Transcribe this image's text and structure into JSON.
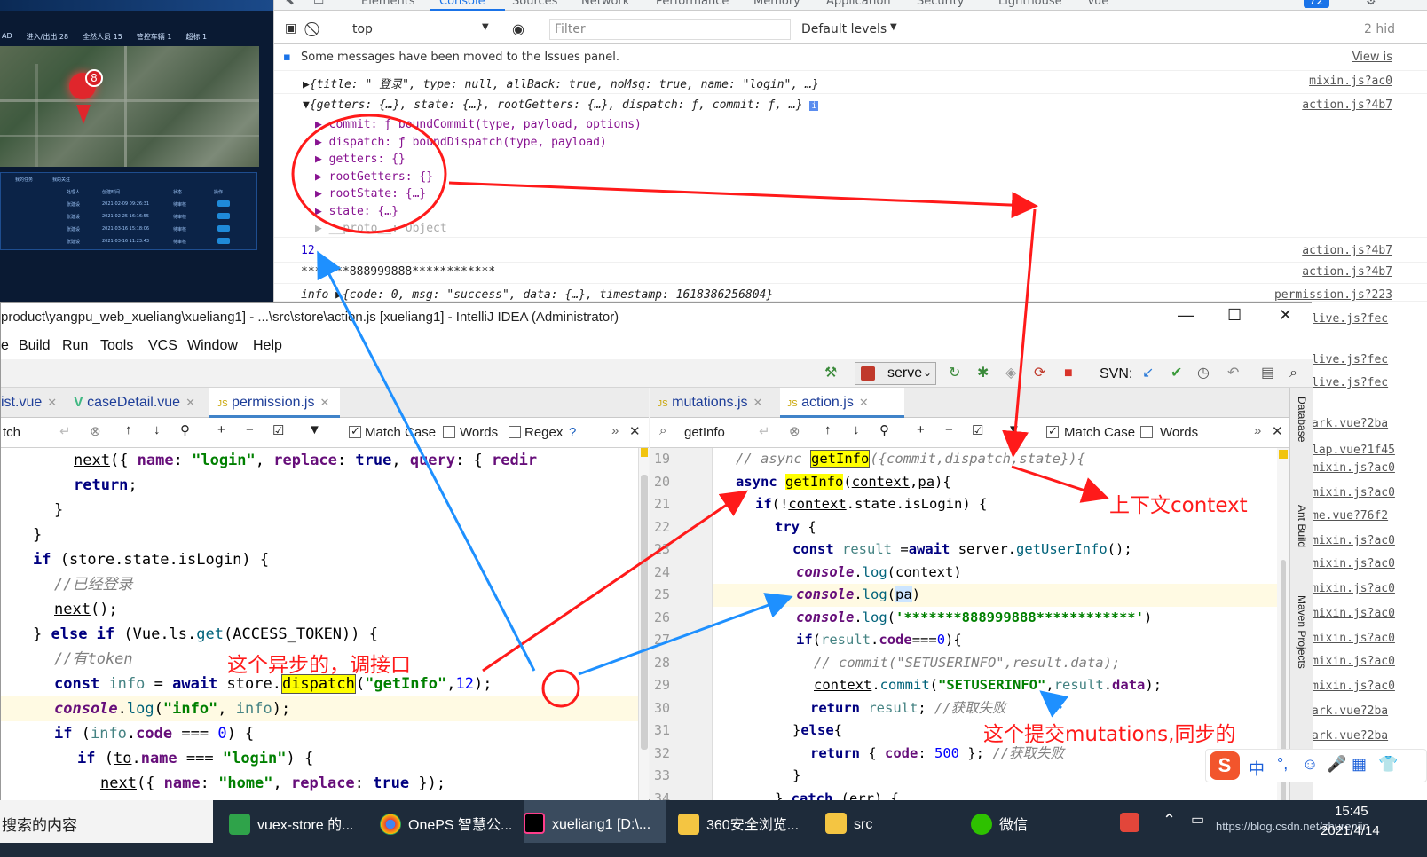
{
  "map_app": {
    "kpis": [
      "AD",
      "进入/出出 28",
      "全然人员 15",
      "管控车辆 1",
      "超标 1"
    ],
    "pin_count": "8",
    "table_header": [
      "我的任务",
      "我的关注"
    ],
    "table_cols": [
      "处理人",
      "创建时间",
      "状态",
      "操作"
    ],
    "table_rows": [
      {
        "who": "张建设",
        "date": "2021-02-09 09:26:31",
        "status": "待审核"
      },
      {
        "who": "张建设",
        "date": "2021-02-25 16:16:55",
        "status": "待审核"
      },
      {
        "who": "张建设",
        "date": "2021-03-16 15:18:06",
        "status": "待审核"
      },
      {
        "who": "张建设",
        "date": "2021-03-16 11:23:43",
        "status": "待审核"
      }
    ]
  },
  "devtools": {
    "tabs": [
      "Elements",
      "Console",
      "Sources",
      "Network",
      "Performance",
      "Memory",
      "Application",
      "Security",
      "Lighthouse",
      "Vue"
    ],
    "badge": "72",
    "context": "top",
    "filter_placeholder": "Filter",
    "levels": "Default levels",
    "hidden": "2 hid",
    "issues_msg": "Some messages have been moved to the Issues panel.",
    "issues_link": "View is",
    "line1": "{title: \"   登录\", type: null, allBack: true, noMsg: true, name: \"login\", …}",
    "line1_src": "mixin.js?ac0",
    "line2": "{getters: {…}, state: {…}, rootGetters: {…}, dispatch: ƒ, commit: ƒ, …}",
    "line2_src": "action.js?4b7",
    "props": [
      "commit: ƒ boundCommit(type, payload, options)",
      "dispatch: ƒ boundDispatch(type, payload)",
      "getters: {}",
      "rootGetters: {}",
      "rootState: {…}",
      "state: {…}",
      "__proto__: Object"
    ],
    "val12": "12",
    "val12_src": "action.js?4b7",
    "stars": "*******888999888************",
    "stars_src": "action.js?4b7",
    "info": "info ▶{code: 0, msg: \"success\", data: {…}, timestamp: 1618386256804}",
    "info_src": "permission.js?223"
  },
  "right_sources": [
    "live.js?fec",
    "live.js?fec",
    "live.js?fec",
    "ark.vue?2ba",
    "lap.vue?1f45",
    "mixin.js?ac0",
    "mixin.js?ac0",
    "me.vue?76f2",
    "mixin.js?ac0",
    "mixin.js?ac0",
    "mixin.js?ac0",
    "mixin.js?ac0",
    "mixin.js?ac0",
    "mixin.js?ac0",
    "mixin.js?ac0",
    "ark.vue?2ba",
    "ark.vue?2ba"
  ],
  "ide": {
    "title": "product\\yangpu_web_xueliang\\xueliang1] - ...\\src\\store\\action.js [xueliang1] - IntelliJ IDEA (Administrator)",
    "menu": [
      "Build",
      "Run",
      "Tools",
      "VCS",
      "Window",
      "Help"
    ],
    "run_config": "serve",
    "svn": "SVN:",
    "left_tabs": [
      "ist.vue",
      "caseDetail.vue",
      "permission.js"
    ],
    "right_tabs": [
      "mutations.js",
      "action.js"
    ],
    "left_search": "tch",
    "right_search": "getInfo",
    "match_case": "Match Case",
    "words": "Words",
    "regex": "Regex",
    "right_gutter": [
      "Database",
      "Ant Build",
      "Maven Projects"
    ],
    "line_numbers": [
      "19",
      "20",
      "21",
      "22",
      "23",
      "24",
      "25",
      "26",
      "27",
      "28",
      "29",
      "30",
      "31",
      "32",
      "33",
      "34"
    ]
  },
  "annotations": {
    "context": "上下文context",
    "async_api": "这个异步的，调接口",
    "mutations": "这个提交mutations,同步的"
  },
  "taskbar": {
    "search": "搜索的内容",
    "items": [
      "vuex-store 的...",
      "OnePS 智慧公...",
      "xueliang1 [D:\\...",
      "360安全浏览...",
      "src",
      "微信"
    ],
    "time": "15:45",
    "date": "2021/4/14",
    "watermark": "https://blog.csdn.net/zhurenjin"
  },
  "ime": [
    "中",
    "°,",
    "☺",
    "🎤",
    "▦",
    "👕"
  ]
}
